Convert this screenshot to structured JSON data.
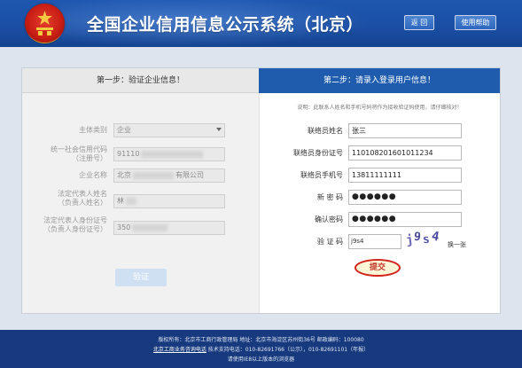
{
  "header": {
    "title": "全国企业信用信息公示系统（北京）",
    "back_label": "返 回",
    "help_label": "使用帮助"
  },
  "steps": {
    "step1": "第一步：验证企业信息！",
    "step2": "第二步：请录入登录用户信息！"
  },
  "left_form": {
    "entity_type_label": "主体类别",
    "entity_type_value": "企业",
    "credit_code_label_1": "统一社会信用代码",
    "credit_code_label_2": "（注册号）",
    "credit_code_value": "91110",
    "company_name_label": "企业名称",
    "company_name_prefix": "北京",
    "company_name_suffix": "有限公司",
    "legal_rep_label_1": "法定代表人姓名",
    "legal_rep_label_2": "（负责人姓名）",
    "legal_rep_value": "林",
    "legal_id_label_1": "法定代表人身份证号",
    "legal_id_label_2": "（负责人身份证号）",
    "legal_id_value": "350",
    "verify_label": "验证"
  },
  "right_form": {
    "notice": "说明：此联系人姓名和手机号码将作为接收验证码使用，请仔细核对！",
    "contact_name_label": "联络员姓名",
    "contact_name_value": "张三",
    "contact_id_label": "联络员身份证号",
    "contact_id_value": "110108201601011234",
    "contact_phone_label": "联络员手机号",
    "contact_phone_value": "13811111111",
    "new_password_label": "新 密 码",
    "new_password_value": "●●●●●●",
    "confirm_password_label": "确认密码",
    "confirm_password_value": "●●●●●●",
    "captcha_label": "验 证 码",
    "captcha_value": "j9s4",
    "captcha_chars": [
      "j",
      "9",
      "s",
      "4"
    ],
    "refresh_label": "换一张",
    "submit_label": "提交"
  },
  "footer": {
    "line1": "版权所有：北京市工商行政管理局    地址：北京市海淀区苏州街36号    邮政编码：100080",
    "line2_link": "北京工商业务咨询电话",
    "line2_rest": "    技术支持电话：010-82691766（公示），010-82691101（年报）",
    "line3": "请使用IE8以上版本的浏览器"
  },
  "colors": {
    "header_blue": "#1e57b0",
    "step_active": "#1f5cae",
    "footer_blue": "#173a7e",
    "submit_red": "#d0241b"
  }
}
